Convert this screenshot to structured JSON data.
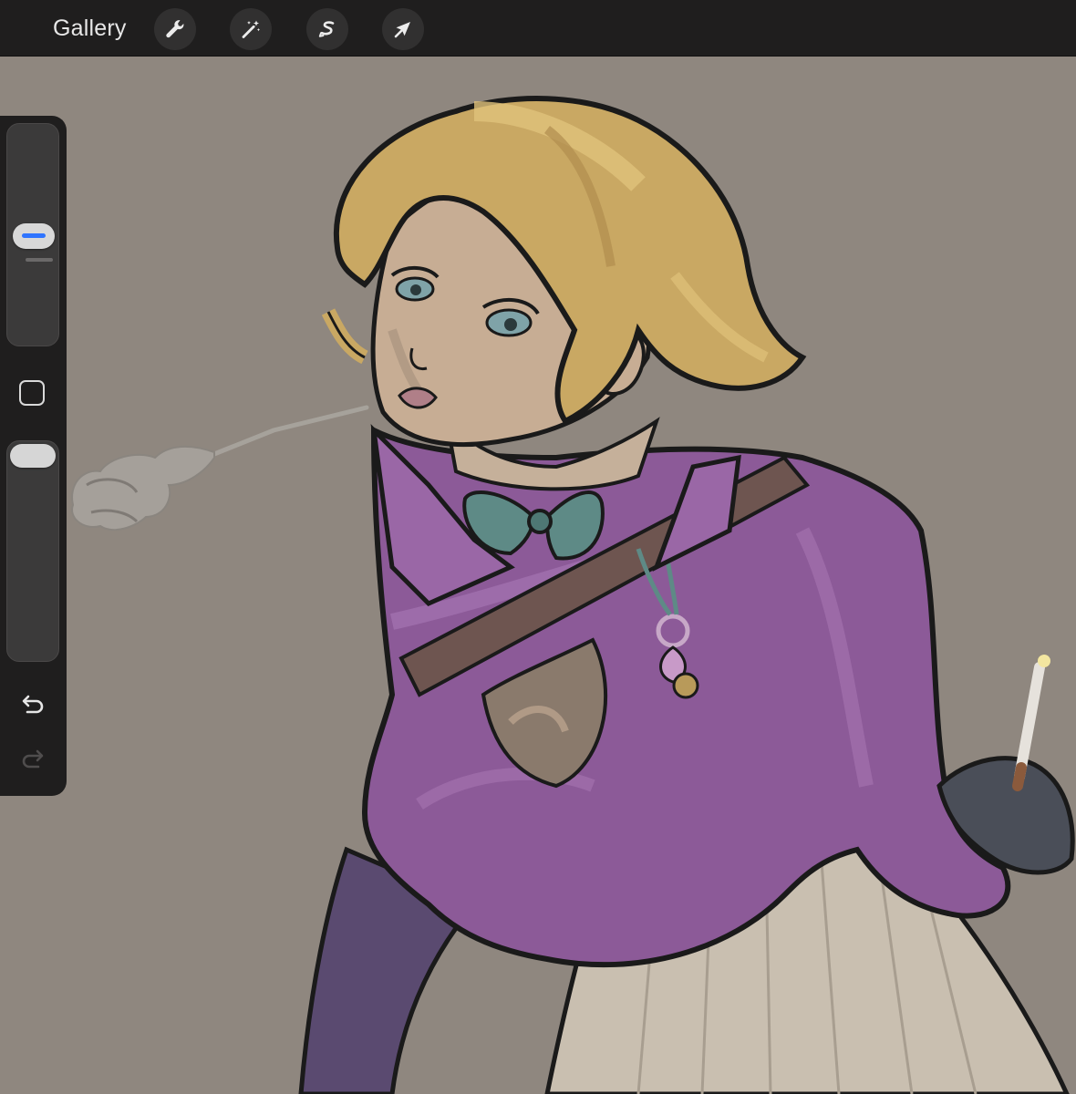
{
  "topbar": {
    "gallery_label": "Gallery",
    "tools": [
      {
        "name": "actions",
        "icon": "wrench-icon"
      },
      {
        "name": "adjustments",
        "icon": "magic-wand-icon"
      },
      {
        "name": "selection",
        "icon": "selection-s-icon"
      },
      {
        "name": "transform",
        "icon": "arrow-cursor-icon"
      }
    ]
  },
  "sidebar": {
    "brush_size_level": 0.5,
    "opacity_level": 1.0,
    "modify_icon": "square-icon",
    "undo_icon": "undo-icon",
    "redo_icon": "redo-icon",
    "redo_enabled": false
  },
  "colors": {
    "toolbar_bg": "#1f1e1e",
    "canvas_bg": "#8f877f",
    "accent": "#2f74ff",
    "jacket": "#8c5a98",
    "hair": "#c9a863",
    "bow": "#5e8a86",
    "skirt": "#c9bfb0"
  }
}
